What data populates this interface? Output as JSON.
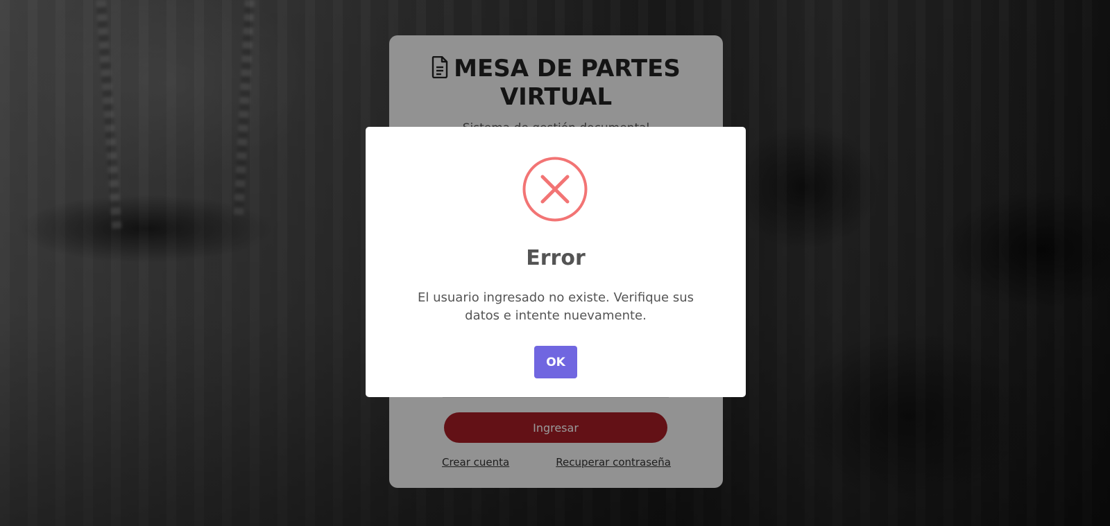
{
  "login": {
    "title": "MESA DE PARTES VIRTUAL",
    "subtitle": "Sistema de gestión documental",
    "submit_label": "Ingresar",
    "create_account_label": "Crear cuenta",
    "recover_password_label": "Recuperar contraseña",
    "icons": {
      "title_icon": "document-icon"
    }
  },
  "alert": {
    "icon": "error-x-icon",
    "title": "Error",
    "message": "El usuario ingresado no existe. Verifique sus datos e intente nuevamente.",
    "confirm_label": "OK"
  },
  "colors": {
    "error": "#f27474",
    "confirm_button": "#7066e0",
    "login_button": "#a51d26"
  }
}
